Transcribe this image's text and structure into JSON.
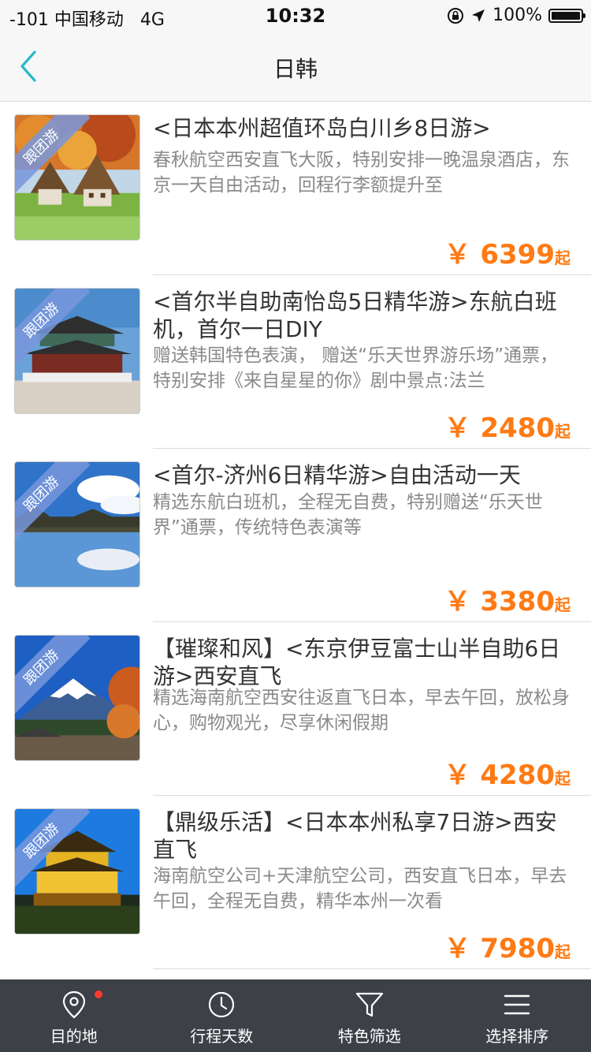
{
  "status_bar": {
    "carrier": "-101 中国移动",
    "network": "4G",
    "time": "10:32",
    "battery": "100%"
  },
  "nav": {
    "title": "日韩",
    "back_icon": "chevron-left-icon"
  },
  "badge_label": "跟团游",
  "currency": "￥",
  "price_suffix": "起",
  "products": [
    {
      "title": "<日本本州超值环岛白川乡8日游>",
      "desc": "春秋航空西安直飞大阪，特别安排一晚温泉酒店，东京一天自由活动，回程行李额提升至",
      "price": "6399",
      "image": "shirakawa-village"
    },
    {
      "title": "<首尔半自助南怡岛5日精华游>东航白班机，首尔一日DIY",
      "desc": "赠送韩国特色表演， 赠送“乐天世界游乐场”通票，特别安排《来自星星的你》剧中景点:法兰",
      "price": "2480",
      "image": "gyeongbokgung-palace"
    },
    {
      "title": "<首尔-济州6日精华游>自由活动一天",
      "desc": "精选东航白班机，全程无自费，特别赠送“乐天世界”通票，传统特色表演等",
      "price": "3380",
      "image": "palace-reflection"
    },
    {
      "title": "【璀璨和风】<东京伊豆富士山半自助6日游>西安直飞",
      "desc": "精选海南航空西安往返直飞日本，早去午回，放松身心，购物观光，尽享休闲假期",
      "price": "4280",
      "image": "mount-fuji"
    },
    {
      "title": "【鼎级乐活】<日本本州私享7日游>西安直飞",
      "desc": "海南航空公司+天津航空公司，西安直飞日本，早去午回，全程无自费，精华本州一次看",
      "price": "7980",
      "image": "golden-pavilion"
    }
  ],
  "tabs": [
    {
      "label": "目的地",
      "icon": "location-pin-icon",
      "has_dot": true
    },
    {
      "label": "行程天数",
      "icon": "clock-icon"
    },
    {
      "label": "特色筛选",
      "icon": "filter-icon"
    },
    {
      "label": "选择排序",
      "icon": "menu-icon"
    }
  ],
  "colors": {
    "price": "#ff7a14",
    "back_arrow": "#2bb7c9",
    "tabbar_bg": "#3d4047",
    "badge_bg": "#7896dc",
    "dot": "#ff3b30"
  }
}
